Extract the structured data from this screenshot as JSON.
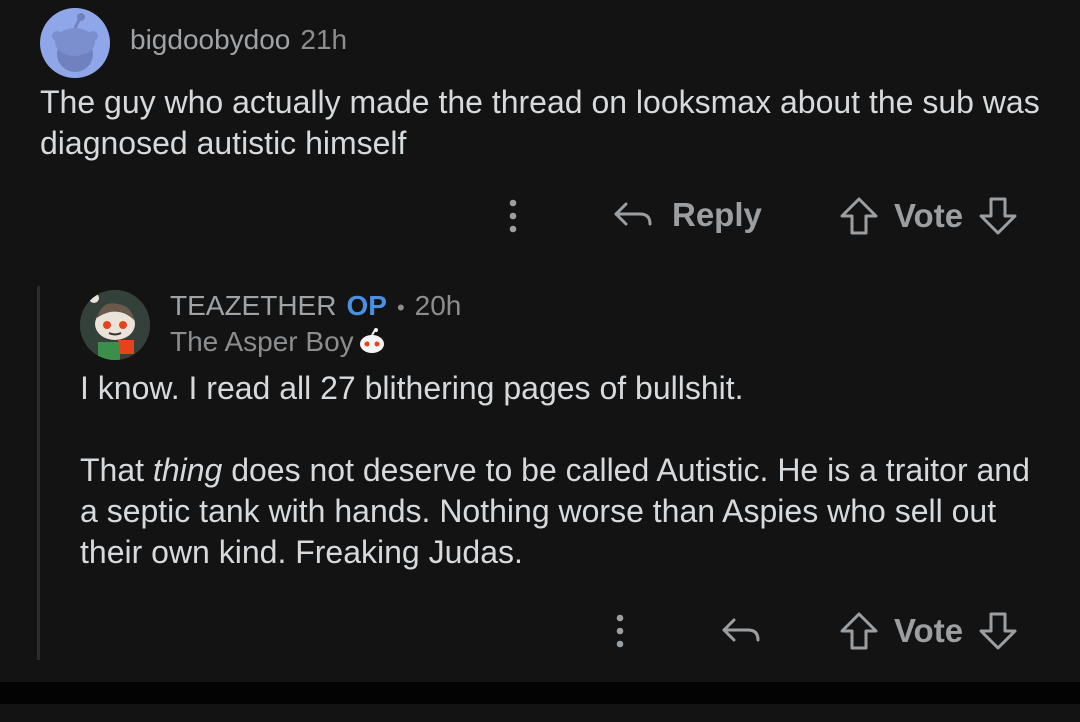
{
  "comment1": {
    "username": "bigdoobydoo",
    "time": "21h",
    "body": "The guy who actually made the thread on looksmax about the sub was diagnosed autistic himself",
    "reply_label": "Reply",
    "vote_label": "Vote"
  },
  "comment2": {
    "username": "TEAZETHER",
    "op_badge": "OP",
    "separator": "•",
    "time": "20h",
    "flair": "The Asper Boy",
    "paragraph1": "I know. I read all 27 blithering pages of bullshit.",
    "paragraph2_before": "That ",
    "paragraph2_em": "thing",
    "paragraph2_after": " does not deserve to be called Autistic. He is a traitor and a septic tank with hands. Nothing worse than Aspies who sell out their own kind. Freaking Judas.",
    "vote_label": "Vote"
  },
  "colors": {
    "background": "#131313",
    "text": "#d7dadc",
    "meta": "#8b8d8f",
    "op_blue": "#4a8fe2",
    "avatar1_bg": "#8fa7e9"
  },
  "icons": [
    "more-vertical-icon",
    "reply-arrow-icon",
    "upvote-icon",
    "downvote-icon"
  ]
}
